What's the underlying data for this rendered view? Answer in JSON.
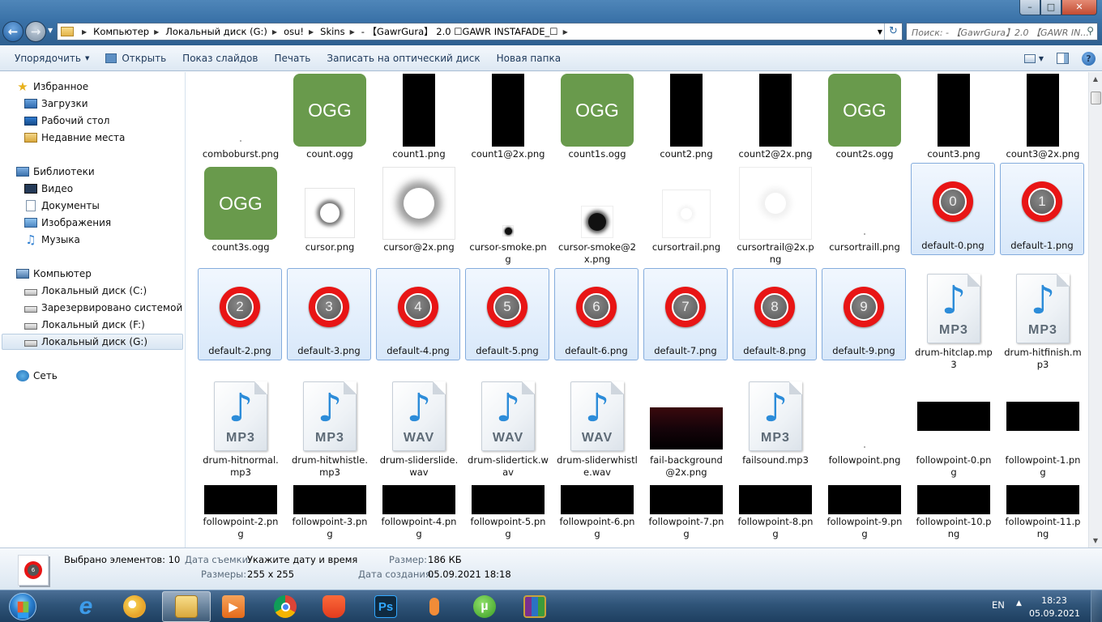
{
  "window": {
    "breadcrumb": [
      "Компьютер",
      "Локальный диск (G:)",
      "osu!",
      "Skins",
      "-    【GawrGura】 2.0 ☐GAWR INSTAFADE_☐"
    ],
    "search_placeholder": "Поиск: -    【GawrGura】2.0 【GAWR IN...",
    "buttons": {
      "minimize": "–",
      "maximize": "□",
      "close": "✕"
    }
  },
  "toolbar": {
    "organize": "Упорядочить",
    "open": "Открыть",
    "slideshow": "Показ слайдов",
    "print": "Печать",
    "burn": "Записать на оптический диск",
    "new_folder": "Новая папка",
    "help": "?"
  },
  "sidebar": {
    "favorites": "Избранное",
    "downloads": "Загрузки",
    "desktop": "Рабочий стол",
    "recent": "Недавние места",
    "libraries": "Библиотеки",
    "video": "Видео",
    "documents": "Документы",
    "images": "Изображения",
    "music": "Музыка",
    "computer": "Компьютер",
    "drive_c": "Локальный диск (C:)",
    "drive_e": "Зарезервировано системой (E:)",
    "drive_f": "Локальный диск (F:)",
    "drive_g": "Локальный диск (G:)",
    "network": "Сеть"
  },
  "files": [
    {
      "name": "comboburst.png",
      "kind": "dot"
    },
    {
      "name": "count.ogg",
      "kind": "ogg",
      "text": "OGG"
    },
    {
      "name": "count1.png",
      "kind": "black"
    },
    {
      "name": "count1@2x.png",
      "kind": "black"
    },
    {
      "name": "count1s.ogg",
      "kind": "ogg",
      "text": "OGG"
    },
    {
      "name": "count2.png",
      "kind": "black"
    },
    {
      "name": "count2@2x.png",
      "kind": "black"
    },
    {
      "name": "count2s.ogg",
      "kind": "ogg",
      "text": "OGG"
    },
    {
      "name": "count3.png",
      "kind": "black"
    },
    {
      "name": "count3@2x.png",
      "kind": "black"
    },
    {
      "name": "count3s.ogg",
      "kind": "ogg",
      "text": "OGG"
    },
    {
      "name": "cursor.png",
      "kind": "cursor"
    },
    {
      "name": "cursor@2x.png",
      "kind": "cursor2"
    },
    {
      "name": "cursor-smoke.png",
      "kind": "smoke"
    },
    {
      "name": "cursor-smoke@2x.png",
      "kind": "smoke2"
    },
    {
      "name": "cursortrail.png",
      "kind": "trail"
    },
    {
      "name": "cursortrail@2x.png",
      "kind": "trail2"
    },
    {
      "name": "cursortraill.png",
      "kind": "dot"
    },
    {
      "name": "default-0.png",
      "kind": "num",
      "text": "0",
      "selected": true
    },
    {
      "name": "default-1.png",
      "kind": "num",
      "text": "1",
      "selected": true
    },
    {
      "name": "default-2.png",
      "kind": "num",
      "text": "2",
      "selected": true
    },
    {
      "name": "default-3.png",
      "kind": "num",
      "text": "3",
      "selected": true
    },
    {
      "name": "default-4.png",
      "kind": "num",
      "text": "4",
      "selected": true
    },
    {
      "name": "default-5.png",
      "kind": "num",
      "text": "5",
      "selected": true
    },
    {
      "name": "default-6.png",
      "kind": "num",
      "text": "6",
      "selected": true
    },
    {
      "name": "default-7.png",
      "kind": "num",
      "text": "7",
      "selected": true
    },
    {
      "name": "default-8.png",
      "kind": "num",
      "text": "8",
      "selected": true
    },
    {
      "name": "default-9.png",
      "kind": "num",
      "text": "9",
      "selected": true
    },
    {
      "name": "drum-hitclap.mp3",
      "kind": "audio",
      "text": "MP3"
    },
    {
      "name": "drum-hitfinish.mp3",
      "kind": "audio",
      "text": "MP3"
    },
    {
      "name": "drum-hitnormal.mp3",
      "kind": "audio",
      "text": "MP3"
    },
    {
      "name": "drum-hitwhistle.mp3",
      "kind": "audio",
      "text": "MP3"
    },
    {
      "name": "drum-sliderslide.wav",
      "kind": "audio",
      "text": "WAV"
    },
    {
      "name": "drum-slidertick.wav",
      "kind": "audio",
      "text": "WAV"
    },
    {
      "name": "drum-sliderwhistle.wav",
      "kind": "audio",
      "text": "WAV"
    },
    {
      "name": "fail-background@2x.png",
      "kind": "widegrad"
    },
    {
      "name": "failsound.mp3",
      "kind": "audio",
      "text": "MP3"
    },
    {
      "name": "followpoint.png",
      "kind": "dot"
    },
    {
      "name": "followpoint-0.png",
      "kind": "wide"
    },
    {
      "name": "followpoint-1.png",
      "kind": "wide"
    },
    {
      "name": "followpoint-2.png",
      "kind": "wide"
    },
    {
      "name": "followpoint-3.png",
      "kind": "wide"
    },
    {
      "name": "followpoint-4.png",
      "kind": "wide"
    },
    {
      "name": "followpoint-5.png",
      "kind": "wide"
    },
    {
      "name": "followpoint-6.png",
      "kind": "wide"
    },
    {
      "name": "followpoint-7.png",
      "kind": "wide"
    },
    {
      "name": "followpoint-8.png",
      "kind": "wide"
    },
    {
      "name": "followpoint-9.png",
      "kind": "wide"
    },
    {
      "name": "followpoint-10.png",
      "kind": "wide"
    },
    {
      "name": "followpoint-11.png",
      "kind": "wide"
    }
  ],
  "details": {
    "selected": "Выбрано элементов: 10",
    "date_taken_label": "Дата съемки:",
    "date_taken_value": "Укажите дату и время",
    "size_label": "Размер:",
    "size_value": "186 КБ",
    "dims_label": "Размеры:",
    "dims_value": "255 x 255",
    "created_label": "Дата создания:",
    "created_value": "05.09.2021 18:18",
    "preview_number": "6"
  },
  "taskbar": {
    "lang": "EN",
    "time": "18:23",
    "date": "05.09.2021",
    "apps": [
      "explorer",
      "internet-explorer",
      "paint",
      "folder",
      "media-player",
      "chrome",
      "brave",
      "photoshop",
      "microphone",
      "utorrent",
      "winrar"
    ],
    "ps_text": "Ps",
    "ie_text": "e"
  }
}
